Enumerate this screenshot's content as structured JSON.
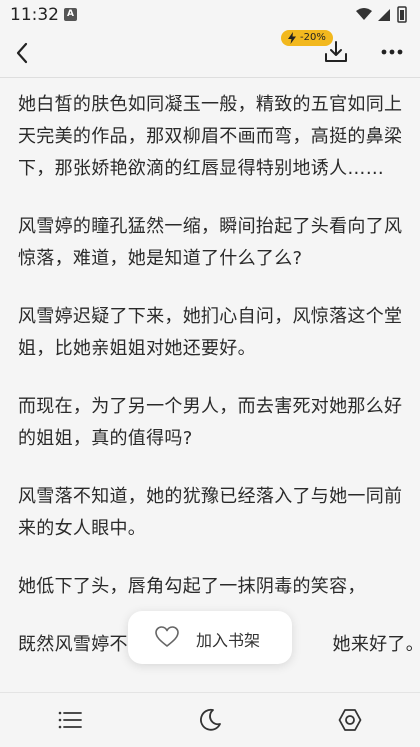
{
  "status_bar": {
    "time": "11:32",
    "notification_letter": "A"
  },
  "top_bar": {
    "badge_text": "-20%"
  },
  "content": {
    "paragraphs": [
      "她白皙的肤色如同凝玉一般，精致的五官如同上天完美的作品，那双柳眉不画而弯，高挺的鼻梁下，那张娇艳欲滴的红唇显得特别地诱人……",
      "风雪婷的瞳孔猛然一缩，瞬间抬起了头看向了风惊落，难道，她是知道了什么了么?",
      "风雪婷迟疑了下来，她扪心自问，风惊落这个堂姐，比她亲姐姐对她还要好。",
      "而现在，为了另一个男人，而去害死对她那么好的姐姐，真的值得吗?",
      "风雪落不知道，她的犹豫已经落入了与她一同前来的女人眼中。",
      "她低下了头，唇角勾起了一抹阴毒的笑容，",
      "既然风雪婷不                                  她来好了。"
    ]
  },
  "toast": {
    "label": "加入书架"
  },
  "colors": {
    "background": "#f5f5f5",
    "badge": "#f2b81e",
    "text": "#2a2a2a"
  },
  "icons": {
    "back": "back-arrow-icon",
    "download": "download-icon",
    "more": "more-dots-icon",
    "heart": "heart-icon",
    "catalog": "list-menu-icon",
    "night": "moon-icon",
    "settings": "hexagon-settings-icon"
  }
}
